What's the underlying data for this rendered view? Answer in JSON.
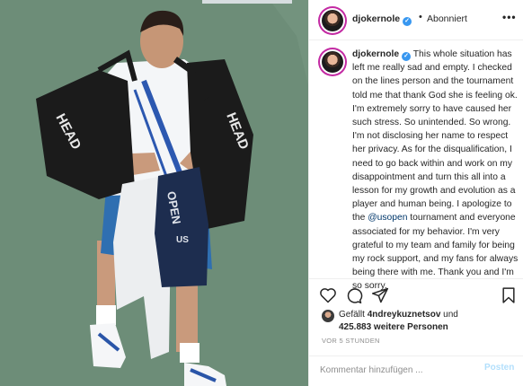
{
  "post": {
    "username": "djokernole",
    "follow_status": "Abonniert",
    "header_separator": "•",
    "more_glyph": "•••",
    "verified_glyph": "✓"
  },
  "caption": {
    "username": "djokernole",
    "text_before_mention": "This whole situation has left me really sad and empty. I checked on the lines person and the tournament told me that thank God she is feeling ok. I'm extremely sorry to have caused her such stress. So unintended. So wrong. I'm not disclosing her name to respect her privacy. As for the disqualification, I need to go back within and work on my disappointment and turn this all into a lesson for my growth and evolution as a player and human being. I apologize to the ",
    "mention": "@usopen",
    "text_after_mention": " tournament and everyone associated for my behavior. I'm very grateful to my team and family for being my rock support, and my fans for always being there with me. Thank you and I'm so sorry."
  },
  "actions": {
    "icons": [
      "heart-icon",
      "comment-icon",
      "share-icon",
      "bookmark-icon"
    ]
  },
  "likes": {
    "prefix": "Gefällt",
    "liker": "4ndreykuznetsov",
    "middle": "und",
    "count": "425.883 weitere Personen"
  },
  "time": "VOR 5 STUNDEN",
  "comment": {
    "placeholder": "Kommentar hinzufügen ...",
    "post_label": "Posten"
  },
  "photo": {
    "court_color": "#6f8c77",
    "shirt_color": "#f4f6f8",
    "towel_color": "#1d2d4f",
    "shorts_color": "#2f6fb1",
    "bag_text": "HEAD"
  }
}
